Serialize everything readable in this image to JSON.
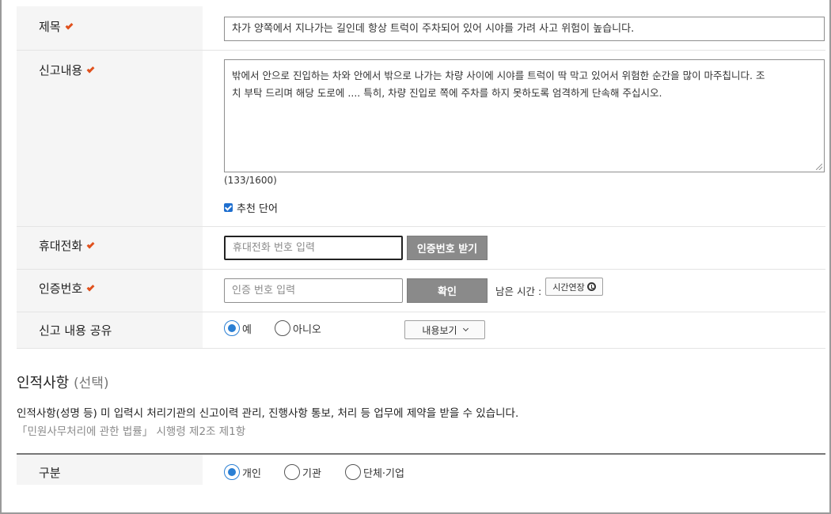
{
  "title_row": {
    "label": "제목",
    "value": "차가 양쪽에서 지나가는 길인데 항상 트럭이 주차되어 있어 시야를 가려 사고 위험이 높습니다."
  },
  "content_row": {
    "label": "신고내용",
    "line1": "밖에서 안으로 진입하는 차와 안에서 밖으로 나가는 차량 사이에 시야를 트럭이 딱 막고 있어서 위험한 순간을 많이 마주칩니다. 조",
    "line2": "치 부탁 드리며 해당 도로에 .... 특히, 차량 진입로 쪽에 주차를 하지 못하도록 엄격하게 단속해 주십시오.",
    "counter": "(133/1600)",
    "recommend_label": "추천 단어",
    "recommend_checked": true
  },
  "phone_row": {
    "label": "휴대전화",
    "placeholder": "휴대전화 번호 입력",
    "button": "인증번호 받기"
  },
  "verify_row": {
    "label": "인증번호",
    "placeholder": "인증 번호 입력",
    "confirm_button": "확인",
    "remaining_label": "남은 시간 :",
    "extend_button": "시간연장",
    "extend_icon": "clock-icon"
  },
  "share_row": {
    "label": "신고 내용 공유",
    "options": [
      "예",
      "아니오"
    ],
    "selected": "예",
    "view_button": "내용보기"
  },
  "personal_section": {
    "title": "인적사항",
    "title_sub": "(선택)",
    "description": "인적사항(성명 등) 미 입력시 처리기관의 신고이력 관리, 진행사항 통보, 처리 등 업무에 제약을 받을 수 있습니다.",
    "law": "「민원사무처리에 관한 법률」 시행령 제2조 제1항"
  },
  "category_row": {
    "label": "구분",
    "options": [
      "개인",
      "기관",
      "단체·기업"
    ],
    "selected": "개인"
  },
  "colors": {
    "required_mark": "#e0511d",
    "radio_accent": "#2a7fd4",
    "button_gray": "#8a8a8a"
  }
}
